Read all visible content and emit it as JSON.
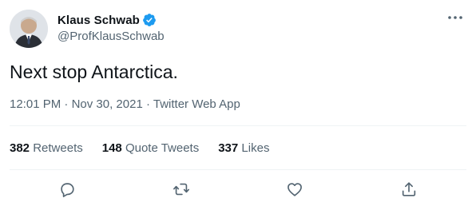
{
  "user": {
    "display_name": "Klaus Schwab",
    "handle": "@ProfKlausSchwab",
    "verified": true
  },
  "tweet": {
    "text": "Next stop Antarctica."
  },
  "meta": {
    "time": "12:01 PM",
    "separator": " · ",
    "date": "Nov 30, 2021",
    "source": "Twitter Web App"
  },
  "stats": {
    "retweets_count": "382",
    "retweets_label": "Retweets",
    "quotes_count": "148",
    "quotes_label": "Quote Tweets",
    "likes_count": "337",
    "likes_label": "Likes"
  },
  "icons": {
    "more": "more-horizontal-icon",
    "reply": "reply-icon",
    "retweet": "retweet-icon",
    "like": "heart-icon",
    "share": "share-icon",
    "verified": "verified-badge-icon"
  },
  "colors": {
    "text_primary": "#0f1419",
    "text_secondary": "#536471",
    "verified_blue": "#1d9bf0",
    "divider": "#eff3f4"
  }
}
